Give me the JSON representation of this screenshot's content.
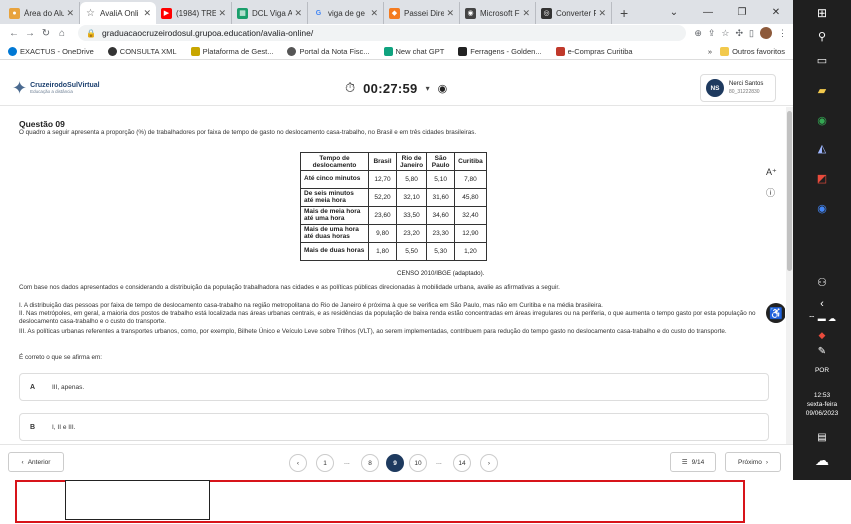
{
  "browser": {
    "tabs": [
      {
        "label": "Área do Alu",
        "icon_color": "#e8a33d",
        "active": false
      },
      {
        "label": "AvaliA Onli",
        "icon_color": "#666666",
        "active": true
      },
      {
        "label": "(1984) TRE",
        "icon_color": "#ff0000",
        "active": false
      },
      {
        "label": "DCL Viga A",
        "icon_color": "#1a9e6b",
        "active": false
      },
      {
        "label": "viga de ge",
        "icon_color": "#4285f4",
        "active": false
      },
      {
        "label": "Passei Dire",
        "icon_color": "#f47b20",
        "active": false
      },
      {
        "label": "Microsoft F",
        "icon_color": "#444444",
        "active": false
      },
      {
        "label": "Converter F",
        "icon_color": "#333333",
        "active": false
      }
    ],
    "new_tab_glyph": "+",
    "url": "graduacaocruzeirodosul.grupoa.education/avalia-online/",
    "bookmarks": [
      {
        "label": "EXACTUS - OneDrive",
        "color": "#0078d4"
      },
      {
        "label": "CONSULTA XML",
        "color": "#333333"
      },
      {
        "label": "Plataforma de Gest...",
        "color": "#c8a600"
      },
      {
        "label": "Portal da Nota Fisc...",
        "color": "#555555"
      },
      {
        "label": "New chat GPT",
        "color": "#10a37f"
      },
      {
        "label": "Ferragens - Golden...",
        "color": "#222222"
      },
      {
        "label": "e-Compras Curitiba",
        "color": "#c0392b"
      }
    ],
    "bookmarks_more": "»",
    "other_favorites": "Outros favoritos"
  },
  "header": {
    "logo_title": "CruzeirodoSulVirtual",
    "logo_subtitle": "Educação a distância",
    "timer": "00:27:59",
    "user_initials": "NS",
    "user_name": "Nerci Santos",
    "user_id": "80_31222830"
  },
  "question": {
    "title": "Questão 09",
    "statement": "O quadro a seguir apresenta a proporção (%) de trabalhadores por faixa de tempo de gasto no deslocamento casa-trabalho, no Brasil e em três cidades brasileiras.",
    "table": {
      "headers": [
        "Tempo de deslocamento",
        "Brasil",
        "Rio de Janeiro",
        "São Paulo",
        "Curitiba"
      ],
      "rows": [
        [
          "Até cinco minutos",
          "12,70",
          "5,80",
          "5,10",
          "7,80"
        ],
        [
          "De seis minutos até meia hora",
          "52,20",
          "32,10",
          "31,60",
          "45,80"
        ],
        [
          "Mais de meia hora até uma hora",
          "23,60",
          "33,50",
          "34,60",
          "32,40"
        ],
        [
          "Mais de uma hora até duas horas",
          "9,80",
          "23,20",
          "23,30",
          "12,90"
        ],
        [
          "Mais de duas horas",
          "1,80",
          "5,50",
          "5,30",
          "1,20"
        ]
      ],
      "source": "CENSO 2010/IBGE (adaptado)."
    },
    "intro": "Com base nos dados apresentados e considerando a distribuição da população trabalhadora nas cidades e as políticas públicas direcionadas à mobilidade urbana, avalie as afirmativas a seguir.",
    "statements": [
      "I. A distribuição das pessoas por faixa de tempo de deslocamento casa-trabalho na região metropolitana do Rio de Janeiro é próxima à que se verifica em São Paulo, mas não em Curitiba e na média brasileira.",
      "II. Nas metrópoles, em geral, a maioria dos postos de trabalho está localizada nas áreas urbanas centrais, e as residências da população de baixa renda estão concentradas em áreas irregulares ou na periferia, o que aumenta o tempo gasto por esta população no deslocamento casa-trabalho e o custo do transporte.",
      "III. As políticas urbanas referentes a transportes urbanos, como, por exemplo, Bilhete Único e Veículo Leve sobre Trilhos (VLT), ao serem implementadas, contribuem para redução do tempo gasto no deslocamento casa-trabalho e do custo do transporte."
    ],
    "prompt": "É correto o que se afirma em:",
    "options": [
      {
        "letter": "A",
        "text": "III, apenas."
      },
      {
        "letter": "B",
        "text": "I, II e III."
      }
    ]
  },
  "footer": {
    "prev_label": "Anterior",
    "next_label": "Próximo",
    "pages": [
      "1",
      "8",
      "9",
      "10",
      "14"
    ],
    "current_page": "9",
    "ellipsis": "...",
    "counter": "9/14"
  },
  "taskbar": {
    "language": "POR",
    "time": "12:53",
    "weekday": "sexta-feira",
    "date": "09/06/2023"
  }
}
